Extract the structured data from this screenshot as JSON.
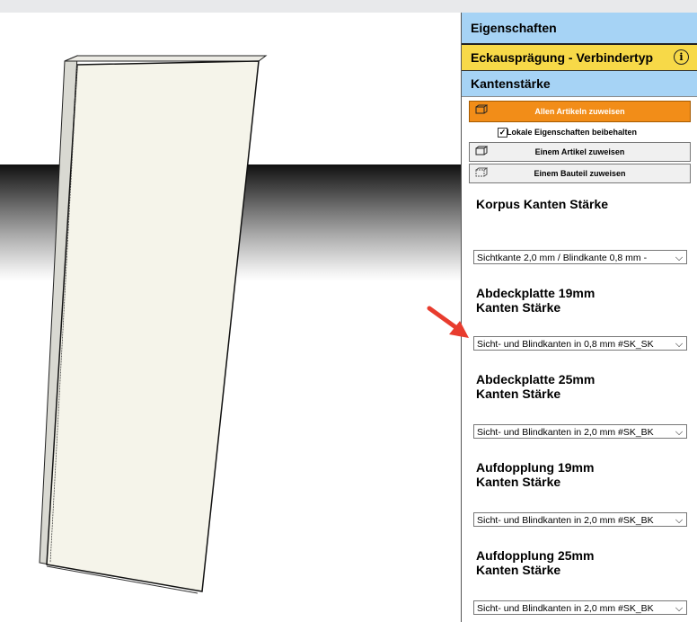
{
  "panel": {
    "header": "Eigenschaften",
    "connector_type": "Eckausprägung - Verbindertyp",
    "section": "Kantenstärke",
    "btn_all": "Allen Artikeln zuweisen",
    "keep_local": "Lokale Eigenschaften beibehalten",
    "keep_local_checked": true,
    "btn_one_article": "Einem Artikel zuweisen",
    "btn_one_part": "Einem Bauteil zuweisen",
    "props": [
      {
        "label": "Korpus Kanten Stärke",
        "value": "Sichtkante 2,0 mm / Blindkante 0,8 mm - "
      },
      {
        "label": "Abdeckplatte 19mm\nKanten Stärke",
        "value": "Sicht- und Blindkanten in 0,8 mm #SK_SK"
      },
      {
        "label": "Abdeckplatte 25mm\nKanten Stärke",
        "value": "Sicht- und Blindkanten in 2,0 mm #SK_BK"
      },
      {
        "label": "Aufdopplung 19mm\nKanten Stärke",
        "value": "Sicht- und Blindkanten in 2,0 mm #SK_BK"
      },
      {
        "label": "Aufdopplung 25mm\nKanten Stärke",
        "value": "Sicht- und Blindkanten in 2,0 mm #SK_BK"
      }
    ]
  },
  "colors": {
    "header_bg": "#a6d3f5",
    "connector_bg": "#f7d948",
    "button_active": "#f28d18",
    "annotation_arrow": "#e83c2e"
  },
  "icons": {
    "info": "info-circle-icon",
    "cabinet": "cabinet-icon",
    "dropdown": "chevron-down-icon",
    "arrow": "red-annotation-arrow"
  }
}
